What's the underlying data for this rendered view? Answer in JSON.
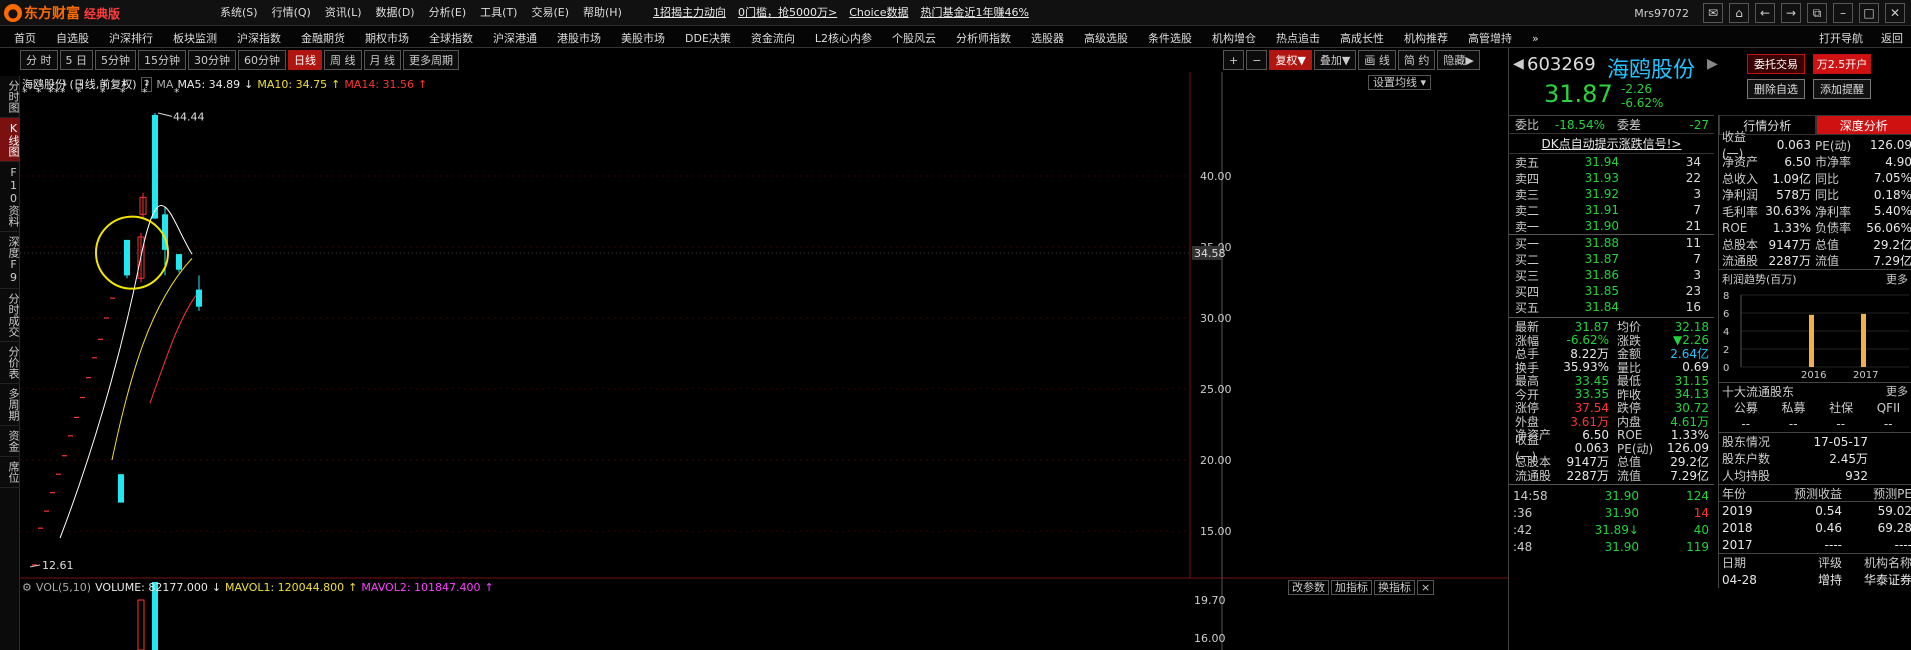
{
  "title_bar": {
    "brand": "东方财富",
    "edition": "经典版",
    "menu": [
      "系统(S)",
      "行情(Q)",
      "资讯(L)",
      "数据(D)",
      "分析(E)",
      "工具(T)",
      "交易(E)",
      "帮助(H)"
    ],
    "links": [
      "1招揭主力动向",
      "0门槛，抢5000万>",
      "Choice数据",
      "热门基金近1年赚46%"
    ],
    "user": "Mrs97072",
    "icons": [
      "mail-icon",
      "home-icon",
      "back-icon",
      "forward-icon",
      "popout-icon",
      "minimize-icon",
      "maximize-icon",
      "close-icon"
    ]
  },
  "nav": {
    "items": [
      "首页",
      "自选股",
      "沪深排行",
      "板块监测",
      "沪深指数",
      "金融期货",
      "期权市场",
      "全球指数",
      "沪深港通",
      "港股市场",
      "美股市场",
      "DDE决策",
      "资金流向",
      "L2核心内参",
      "个股风云",
      "分析师指数",
      "选股器",
      "高级选股",
      "条件选股",
      "机构增仓",
      "热点追击",
      "高成长性",
      "机构推荐",
      "高管增持",
      "»"
    ],
    "right": [
      "打开导航",
      "返回"
    ]
  },
  "left_sidebar": [
    "分时图",
    "K线图",
    "F10资料",
    "深度F9",
    "分时成交",
    "分价表",
    "多周期",
    "资金",
    "席位"
  ],
  "period_toolbar": {
    "items": [
      "分 时",
      "5 日",
      "5分钟",
      "15分钟",
      "30分钟",
      "60分钟",
      "日线",
      "周 线",
      "月 线",
      "更多周期"
    ],
    "active": "日线"
  },
  "chart_toolbar": [
    "+",
    "−",
    "复权",
    "叠加",
    "画 线",
    "简 约",
    "隐藏"
  ],
  "chart_header": {
    "stock": "海鸥股份 (日线,前复权)",
    "ma_tag": "MA",
    "ma5": "MA5: 34.89",
    "ma10": "MA10: 34.75",
    "ma14": "MA14: 31.56",
    "set_ma": "设置均线",
    "high_label": "44.44",
    "low_label": "12.61",
    "current_tag": "34.58",
    "price_axis": [
      "40.00",
      "35.00",
      "30.00",
      "25.00",
      "20.00",
      "15.00"
    ]
  },
  "volume_header": {
    "label": "VOL(5,10)",
    "volume": "VOLUME: 82177.000",
    "mavol1": "MAVOL1: 120044.800",
    "mavol2": "MAVOL2: 101847.400",
    "buttons": [
      "改参数",
      "加指标",
      "换指标",
      "×"
    ],
    "axis": [
      "19.70",
      "16.00"
    ]
  },
  "chart_data": {
    "type": "candlestick",
    "title": "海鸥股份 (日线,前复权)",
    "y_axis_ticks": [
      15.0,
      20.0,
      25.0,
      30.0,
      35.0,
      40.0
    ],
    "price_annotations": {
      "high": 44.44,
      "low": 12.61,
      "current_line": 34.58
    },
    "candles": [
      {
        "open": 17.0,
        "close": 19.0,
        "high": 19.0,
        "low": 17.0,
        "color": "cyan"
      },
      {
        "open": 33.0,
        "close": 35.5,
        "high": 35.5,
        "low": 32.8,
        "color": "cyan"
      },
      {
        "open": 32.8,
        "close": 35.7,
        "high": 36.0,
        "low": 32.5,
        "color": "red"
      },
      {
        "open": 37.3,
        "close": 38.5,
        "high": 38.8,
        "low": 37.0,
        "color": "red"
      },
      {
        "open": 37.0,
        "close": 44.3,
        "high": 44.44,
        "low": 37.0,
        "color": "cyan"
      },
      {
        "open": 37.3,
        "close": 34.8,
        "high": 37.8,
        "low": 33.0,
        "color": "cyan"
      },
      {
        "open": 34.5,
        "close": 33.4,
        "high": 34.5,
        "low": 33.2,
        "color": "cyan"
      },
      {
        "open": 32.0,
        "close": 30.8,
        "high": 33.0,
        "low": 30.5,
        "color": "cyan"
      }
    ],
    "volume_axis": [
      16.0,
      19.7
    ]
  },
  "quote": {
    "code": "603269",
    "name": "海鸥股份",
    "buttons": [
      "委托交易",
      "万2.5开户",
      "删除自选",
      "添加提醒"
    ],
    "price": "31.87",
    "change": "-2.26",
    "change_pct": "-6.62%",
    "weibi": "-18.54%",
    "weicha": "-27",
    "dk_signal": "DK点自动提示涨跌信号!>",
    "sell": [
      {
        "label": "卖五",
        "price": "31.94",
        "vol": "34"
      },
      {
        "label": "卖四",
        "price": "31.93",
        "vol": "22"
      },
      {
        "label": "卖三",
        "price": "31.92",
        "vol": "3"
      },
      {
        "label": "卖二",
        "price": "31.91",
        "vol": "7"
      },
      {
        "label": "卖一",
        "price": "31.90",
        "vol": "21"
      }
    ],
    "buy": [
      {
        "label": "买一",
        "price": "31.88",
        "vol": "11"
      },
      {
        "label": "买二",
        "price": "31.87",
        "vol": "7"
      },
      {
        "label": "买三",
        "price": "31.86",
        "vol": "3"
      },
      {
        "label": "买四",
        "price": "31.85",
        "vol": "23"
      },
      {
        "label": "买五",
        "price": "31.84",
        "vol": "16"
      }
    ],
    "stats": [
      [
        "最新",
        "31.87",
        "均价",
        "32.18"
      ],
      [
        "涨幅",
        "-6.62%",
        "涨跌",
        "▼2.26"
      ],
      [
        "总手",
        "8.22万",
        "金额",
        "2.64亿"
      ],
      [
        "换手",
        "35.93%",
        "量比",
        "0.69"
      ],
      [
        "最高",
        "33.45",
        "最低",
        "31.15"
      ],
      [
        "今开",
        "33.35",
        "昨收",
        "34.13"
      ],
      [
        "涨停",
        "37.54",
        "跌停",
        "30.72"
      ],
      [
        "外盘",
        "3.61万",
        "内盘",
        "4.61万"
      ],
      [
        "净资产",
        "6.50",
        "ROE",
        "1.33%"
      ],
      [
        "收益(一)",
        "0.063",
        "PE(动)",
        "126.09"
      ],
      [
        "总股本",
        "9147万",
        "总值",
        "29.2亿"
      ],
      [
        "流通股",
        "2287万",
        "流值",
        "7.29亿"
      ]
    ],
    "ticks": [
      {
        "time": "14:58",
        "price": "31.90",
        "vol": "124"
      },
      {
        "time": ":36",
        "price": "31.90",
        "vol": "14"
      },
      {
        "time": ":42",
        "price": "31.89↓",
        "vol": "40"
      },
      {
        "time": ":48",
        "price": "31.90",
        "vol": "119"
      }
    ]
  },
  "finance": {
    "tabs": [
      "行情分析",
      "深度分析"
    ],
    "active_tab": "深度分析",
    "rows": [
      [
        "收益(一)",
        "0.063",
        "PE(动)",
        "126.09"
      ],
      [
        "净资产",
        "6.50",
        "市净率",
        "4.90"
      ],
      [
        "总收入",
        "1.09亿",
        "同比",
        "7.05%"
      ],
      [
        "净利润",
        "578万",
        "同比",
        "0.18%"
      ],
      [
        "毛利率",
        "30.63%",
        "净利率",
        "5.40%"
      ],
      [
        "ROE",
        "1.33%",
        "负债率",
        "56.06%"
      ],
      [
        "总股本",
        "9147万",
        "总值",
        "29.2亿"
      ],
      [
        "流通股",
        "2287万",
        "流值",
        "7.29亿"
      ]
    ],
    "profit_title": "利润趋势(百万)",
    "more": "更多",
    "profit_axis": [
      "8",
      "6",
      "4",
      "2",
      "0"
    ],
    "profit_years": [
      "2016",
      "2017"
    ],
    "profit_chart": {
      "type": "bar",
      "categories": [
        "2016",
        "2017"
      ],
      "values": [
        5.8,
        5.9
      ]
    },
    "holders_title": "十大流通股东",
    "holder_cols": [
      "公募",
      "私募",
      "社保",
      "QFII"
    ],
    "holder_vals": [
      "--",
      "--",
      "--",
      "--"
    ],
    "holder_info": [
      [
        "股东情况",
        "17-05-17"
      ],
      [
        "股东户数",
        "2.45万"
      ],
      [
        "人均持股",
        "932"
      ]
    ],
    "forecast_cols": [
      "年份",
      "预测收益",
      "预测PE"
    ],
    "forecast": [
      [
        "2019",
        "0.54",
        "59.02"
      ],
      [
        "2018",
        "0.46",
        "69.28"
      ],
      [
        "2017",
        "----",
        "----"
      ]
    ],
    "rating_cols": [
      "日期",
      "评级",
      "机构名称"
    ],
    "rating_row": [
      "04-28",
      "增持",
      "华泰证券"
    ]
  }
}
